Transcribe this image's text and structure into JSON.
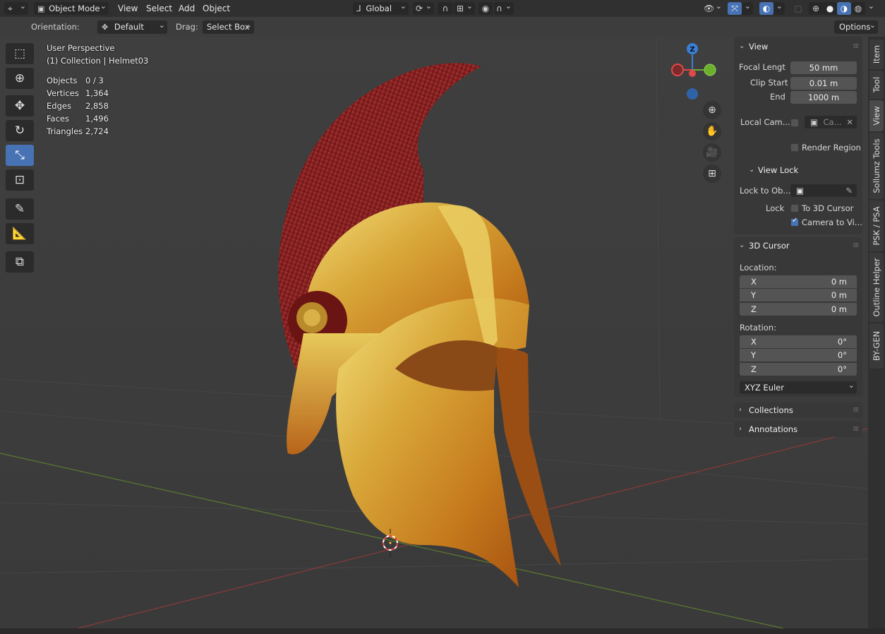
{
  "header": {
    "editor_icon": "viewport-editor-icon",
    "mode": "Object Mode",
    "menus": [
      "View",
      "Select",
      "Add",
      "Object"
    ],
    "transform_orientation": "Global"
  },
  "tool_settings": {
    "orientation_label": "Orientation:",
    "orientation_value": "Default",
    "drag_label": "Drag:",
    "drag_value": "Select Box",
    "options_label": "Options"
  },
  "overlay": {
    "perspective": "User Perspective",
    "collection": "(1) Collection | Helmet03",
    "stats": [
      {
        "label": "Objects",
        "value": "0 / 3"
      },
      {
        "label": "Vertices",
        "value": "1,364"
      },
      {
        "label": "Edges",
        "value": "2,858"
      },
      {
        "label": "Faces",
        "value": "1,496"
      },
      {
        "label": "Triangles",
        "value": "2,724"
      }
    ]
  },
  "gizmo": {
    "z_label": "Z",
    "colors": {
      "x": "#e04a4a",
      "y": "#6ab02e",
      "z": "#3a7fd6"
    }
  },
  "sidebar": {
    "view_panel": {
      "title": "View",
      "focal_length_label": "Focal Lengt",
      "focal_length_value": "50 mm",
      "clip_start_label": "Clip Start",
      "clip_start_value": "0.01 m",
      "end_label": "End",
      "end_value": "1000 m",
      "local_camera_label": "Local Cam...",
      "local_camera_value": "Ca...",
      "render_region_label": "Render Region",
      "render_region_checked": false
    },
    "view_lock": {
      "title": "View Lock",
      "lock_to_object_label": "Lock to Ob...",
      "lock_label": "Lock",
      "to_3d_cursor_label": "To 3D Cursor",
      "to_3d_cursor_checked": false,
      "camera_to_view_label": "Camera to Vi...",
      "camera_to_view_checked": true
    },
    "cursor_panel": {
      "title": "3D Cursor",
      "location_label": "Location:",
      "location": [
        {
          "axis": "X",
          "value": "0 m"
        },
        {
          "axis": "Y",
          "value": "0 m"
        },
        {
          "axis": "Z",
          "value": "0 m"
        }
      ],
      "rotation_label": "Rotation:",
      "rotation": [
        {
          "axis": "X",
          "value": "0°"
        },
        {
          "axis": "Y",
          "value": "0°"
        },
        {
          "axis": "Z",
          "value": "0°"
        }
      ],
      "rotation_mode": "XYZ Euler"
    },
    "collections_title": "Collections",
    "annotations_title": "Annotations"
  },
  "tabs": [
    "Item",
    "Tool",
    "View",
    "Sollumz Tools",
    "PSK / PSA",
    "Outline Helper",
    "BY-GEN"
  ],
  "active_tab": "View"
}
